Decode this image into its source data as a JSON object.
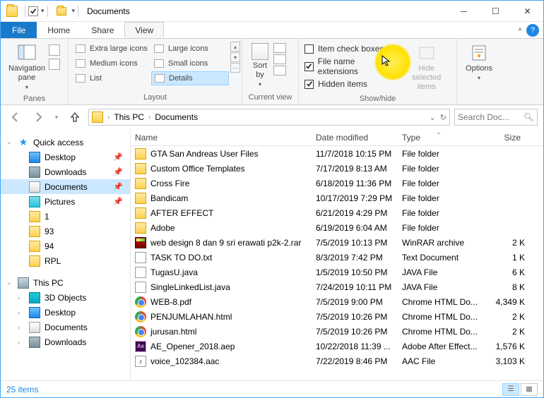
{
  "window": {
    "title": "Documents"
  },
  "tabs": {
    "file": "File",
    "items": [
      "Home",
      "Share",
      "View"
    ],
    "active": 2
  },
  "ribbon": {
    "panes": {
      "nav": "Navigation\npane",
      "label": "Panes"
    },
    "layout": {
      "items": [
        "Extra large icons",
        "Large icons",
        "Medium icons",
        "Small icons",
        "List",
        "Details"
      ],
      "selected": 5,
      "label": "Layout"
    },
    "currentview": {
      "sort": "Sort\nby",
      "label": "Current view"
    },
    "showhide": {
      "itemcheck": "Item check boxes",
      "ext": "File name extensions",
      "hidden": "Hidden items",
      "hidebtn": "Hide selected\nitems",
      "label": "Show/hide"
    },
    "options": "Options"
  },
  "address": {
    "crumbs": [
      "This PC",
      "Documents"
    ],
    "search_placeholder": "Search Doc..."
  },
  "sidebar": {
    "quick": "Quick access",
    "items1": [
      "Desktop",
      "Downloads",
      "Documents",
      "Pictures",
      "1",
      "93",
      "94",
      "RPL"
    ],
    "thispc": "This PC",
    "items2": [
      "3D Objects",
      "Desktop",
      "Documents",
      "Downloads"
    ]
  },
  "columns": {
    "name": "Name",
    "date": "Date modified",
    "type": "Type",
    "size": "Size"
  },
  "files": [
    {
      "icon": "folder",
      "name": "GTA San Andreas User Files",
      "date": "11/7/2018 10:15 PM",
      "type": "File folder",
      "size": ""
    },
    {
      "icon": "folder",
      "name": "Custom Office Templates",
      "date": "7/17/2019 8:13 AM",
      "type": "File folder",
      "size": ""
    },
    {
      "icon": "folder",
      "name": "Cross Fire",
      "date": "6/18/2019 11:36 PM",
      "type": "File folder",
      "size": ""
    },
    {
      "icon": "folder",
      "name": "Bandicam",
      "date": "10/17/2019 7:29 PM",
      "type": "File folder",
      "size": ""
    },
    {
      "icon": "folder",
      "name": "AFTER EFFECT",
      "date": "6/21/2019 4:29 PM",
      "type": "File folder",
      "size": ""
    },
    {
      "icon": "folder",
      "name": "Adobe",
      "date": "6/19/2019 6:04 AM",
      "type": "File folder",
      "size": ""
    },
    {
      "icon": "rar",
      "name": "web design 8 dan 9 sri erawati p2k-2.rar",
      "date": "7/5/2019 10:13 PM",
      "type": "WinRAR archive",
      "size": "2 K"
    },
    {
      "icon": "txt",
      "name": "TASK TO DO.txt",
      "date": "8/3/2019 7:42 PM",
      "type": "Text Document",
      "size": "1 K"
    },
    {
      "icon": "java",
      "name": "TugasU.java",
      "date": "1/5/2019 10:50 PM",
      "type": "JAVA File",
      "size": "6 K"
    },
    {
      "icon": "java",
      "name": "SingleLinkedList.java",
      "date": "7/24/2019 10:11 PM",
      "type": "JAVA File",
      "size": "8 K"
    },
    {
      "icon": "chrome",
      "name": "WEB-8.pdf",
      "date": "7/5/2019 9:00 PM",
      "type": "Chrome HTML Do...",
      "size": "4,349 K"
    },
    {
      "icon": "chrome",
      "name": "PENJUMLAHAN.html",
      "date": "7/5/2019 10:26 PM",
      "type": "Chrome HTML Do...",
      "size": "2 K"
    },
    {
      "icon": "chrome",
      "name": "jurusan.html",
      "date": "7/5/2019 10:26 PM",
      "type": "Chrome HTML Do...",
      "size": "2 K"
    },
    {
      "icon": "ae",
      "name": "AE_Opener_2018.aep",
      "date": "10/22/2018 11:39 ...",
      "type": "Adobe After Effect...",
      "size": "1,576 K"
    },
    {
      "icon": "audio",
      "name": "voice_102384.aac",
      "date": "7/22/2019 8:46 PM",
      "type": "AAC File",
      "size": "3,103 K"
    }
  ],
  "status": {
    "count": "25 items"
  }
}
